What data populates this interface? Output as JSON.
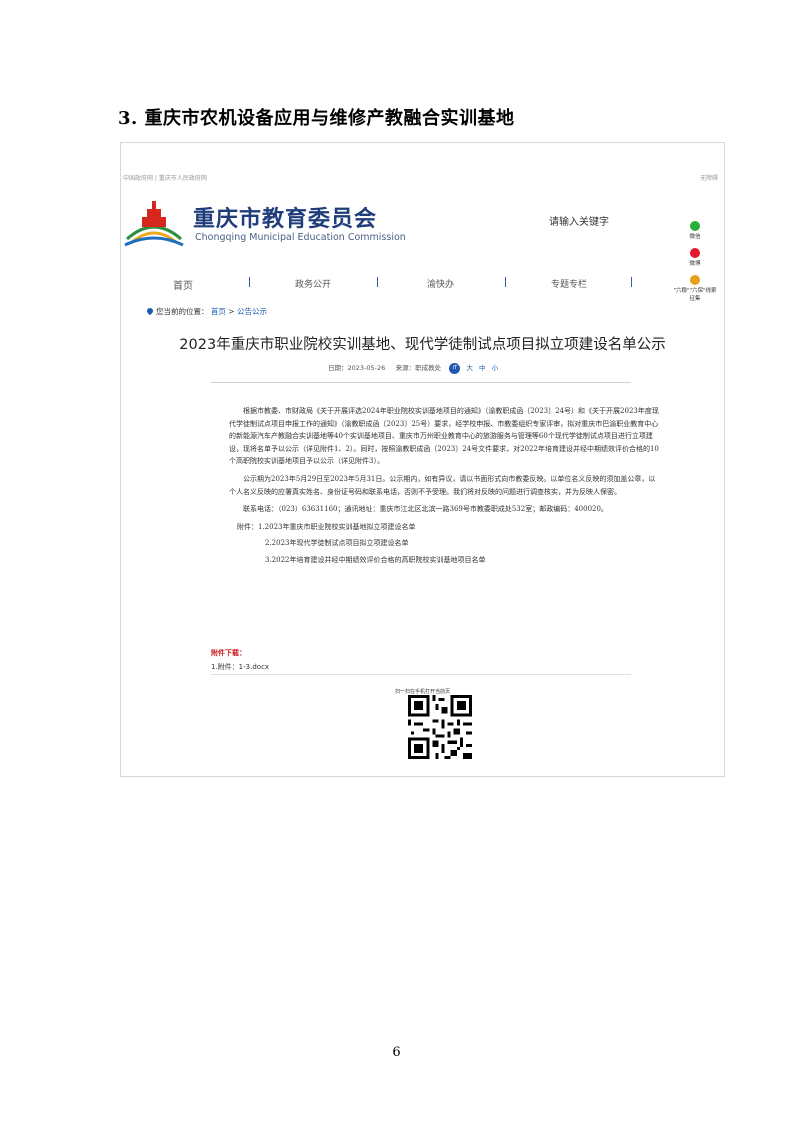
{
  "heading": "3. 重庆市农机设备应用与维修产教融合实训基地",
  "screenshot": {
    "topbar": {
      "left": "中国政府网 | 重庆市人民政府网",
      "right": "无障碍"
    },
    "site_name": "重庆市教育委员会",
    "site_name_en": "Chongqing Municipal Education Commission",
    "search_placeholder": "请输入关键字",
    "social": [
      {
        "label": "微信",
        "icon": "wechat-icon",
        "color": "#2aae3a"
      },
      {
        "label": "微博",
        "icon": "weibo-icon",
        "color": "#e6162d"
      },
      {
        "label": "\"六稳\"\"六保\"线索征集",
        "icon": "clue-icon",
        "color": "#e8a21a"
      }
    ],
    "nav": [
      "首页",
      "政务公开",
      "渝快办",
      "专题专栏"
    ],
    "breadcrumb": {
      "prefix": "您当前的位置：",
      "home": "首页",
      "sep": " > ",
      "current": "公告公示"
    },
    "article_title": "2023年重庆市职业院校实训基地、现代学徒制试点项目拟立项建设名单公示",
    "meta": {
      "date": "日期：2023-05-26",
      "source": "来源：职成教处",
      "font_icon": "iT",
      "sizes": [
        "大",
        "中",
        "小"
      ]
    },
    "paragraphs": [
      "根据市教委、市财政局《关于开展评选2024年职业院校实训基地项目的通知》（渝教职成函〔2023〕24号）和《关于开展2023年度现代学徒制试点项目申报工作的通知》（渝教职成函〔2023〕25号）要求，经学校申报、市教委组织专家评审，拟对重庆市巴渝职业教育中心的新能源汽车产教融合实训基地等40个实训基地项目、重庆市万州职业教育中心的旅游服务与管理等60个现代学徒制试点项目进行立项建设，现将名单予以公示（详见附件1、2）。同时，按照渝教职成函〔2023〕24号文件要求，对2022年培育建设并经中期绩效评价合格的10个高职院校实训基地项目予以公示（详见附件3）。",
      "公示期为2023年5月29日至2023年5月31日。公示期内，如有异议，请以书面形式向市教委反映。以单位名义反映的须加盖公章，以个人名义反映的应署真实姓名、身份证号码和联系电话，否则不予受理。我们将对反映的问题进行调查核实，并为反映人保密。",
      "联系电话：（023）63631160；通讯地址：重庆市江北区北滨一路369号市教委职成处532室；邮政编码：400020。"
    ],
    "attachments": [
      "附件：1.2023年重庆市职业院校实训基地拟立项建设名单",
      "2.2023年现代学徒制试点项目拟立项建设名单",
      "3.2022年培育建设并经中期绩效评价合格的高职院校实训基地项目名单"
    ],
    "download_label": "附件下载：",
    "download_file": "1.附件：1-3.docx",
    "qr_caption": "扫一扫在手机打开当前页"
  },
  "page_number": "6"
}
